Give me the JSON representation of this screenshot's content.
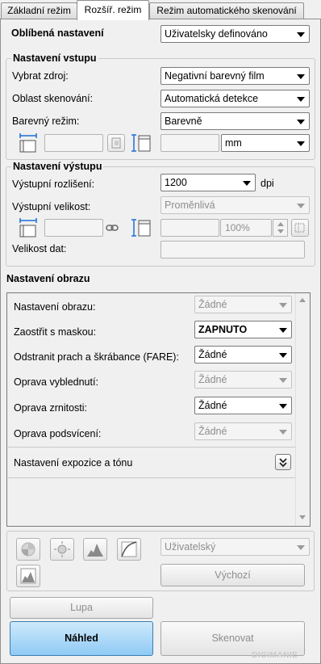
{
  "tabs": [
    {
      "label": "Základní režim"
    },
    {
      "label": "Rozšíř. režim"
    },
    {
      "label": "Režim automatického skenování"
    }
  ],
  "favorite": {
    "label": "Oblíbená nastavení",
    "value": "Uživatelsky definováno"
  },
  "input_settings": {
    "title": "Nastavení vstupu",
    "source_label": "Vybrat zdroj:",
    "source_value": "Negativní barevný film",
    "area_label": "Oblast skenování:",
    "area_value": "Automatická detekce",
    "color_label": "Barevný režim:",
    "color_value": "Barevně",
    "unit_value": "mm"
  },
  "output_settings": {
    "title": "Nastavení výstupu",
    "resolution_label": "Výstupní rozlišení:",
    "resolution_value": "1200",
    "resolution_unit": "dpi",
    "size_label": "Výstupní velikost:",
    "size_value": "Proměnlivá",
    "scale_value": "100%",
    "datasize_label": "Velikost dat:"
  },
  "image_settings": {
    "title": "Nastavení obrazu",
    "rows": [
      {
        "label": "Nastavení obrazu:",
        "value": "Žádné",
        "enabled": false
      },
      {
        "label": "Zaostřit s maskou:",
        "value": "ZAPNUTO",
        "enabled": true
      },
      {
        "label": "Odstranit prach a škrábance (FARE):",
        "value": "Žádné",
        "enabled": true
      },
      {
        "label": "Oprava vyblednutí:",
        "value": "Žádné",
        "enabled": false
      },
      {
        "label": "Oprava zrnitosti:",
        "value": "Žádné",
        "enabled": true
      },
      {
        "label": "Oprava podsvícení:",
        "value": "Žádné",
        "enabled": false
      }
    ],
    "exposure_label": "Nastavení expozice a tónu"
  },
  "tools": {
    "preset_value": "Uživatelský",
    "default_label": "Výchozí"
  },
  "buttons": {
    "zoom_label": "Lupa",
    "preview_label": "Náhled",
    "scan_label": "Skenovat"
  },
  "watermark": {
    "text": "DIGIMANIE"
  },
  "colors": {
    "accent": "#8fcaf5",
    "panel": "#f0f0f0",
    "border": "#8e8f8f"
  }
}
